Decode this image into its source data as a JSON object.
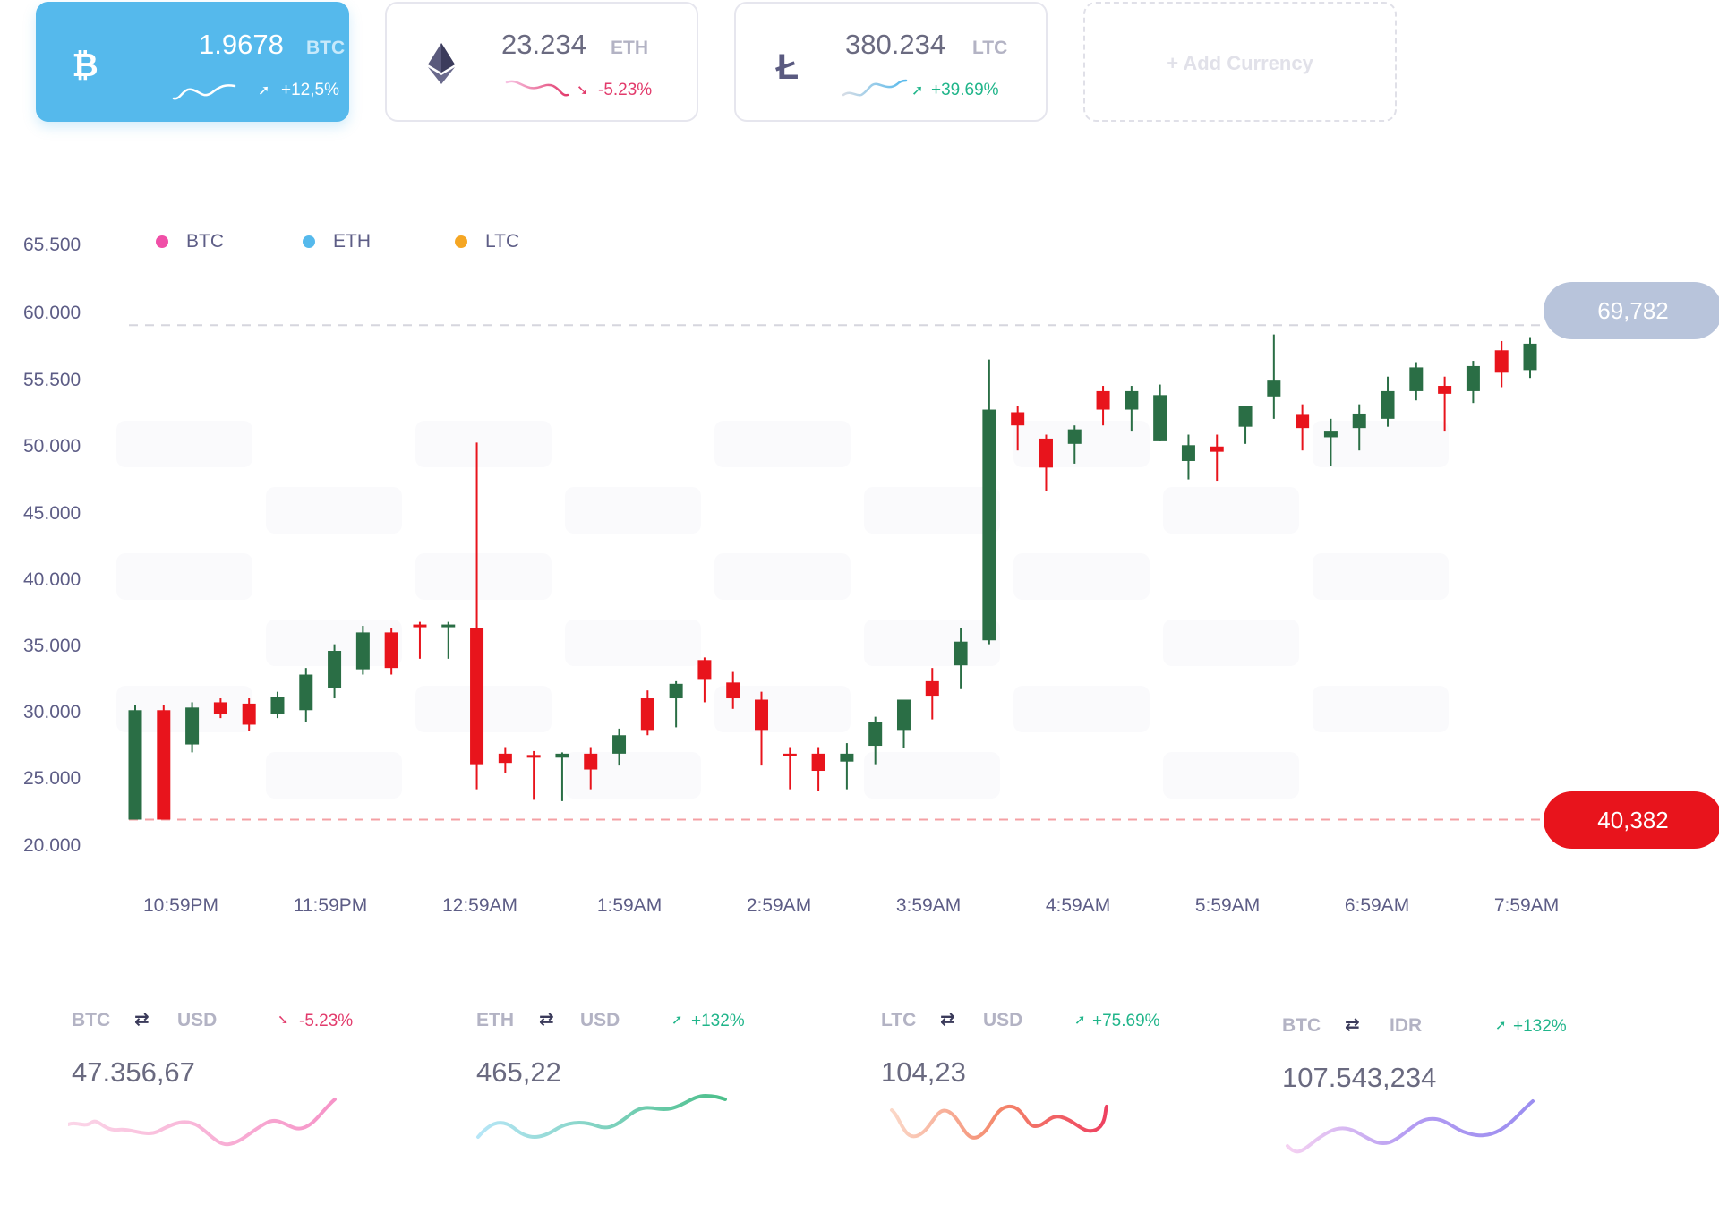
{
  "cards": [
    {
      "amount": "1.9678",
      "symbol": "BTC",
      "change": "+12,5%",
      "direction": "up",
      "coin_icon": "bitcoin-icon"
    },
    {
      "amount": "23.234",
      "symbol": "ETH",
      "change": "-5.23%",
      "direction": "down",
      "coin_icon": "ethereum-icon"
    },
    {
      "amount": "380.234",
      "symbol": "LTC",
      "change": "+39.69%",
      "direction": "up",
      "coin_icon": "litecoin-icon"
    }
  ],
  "add_currency_label": "+ Add Currency",
  "colors": {
    "active_card": "#55b9ec",
    "up": "#2a6e45",
    "down": "#e8141c",
    "pos_text": "#20b58a",
    "neg_text": "#e23a6b",
    "high_pill": "#b8c4db",
    "low_pill": "#e8141c"
  },
  "legend": [
    {
      "label": "BTC",
      "color": "#f04fa7"
    },
    {
      "label": "ETH",
      "color": "#55b9ec"
    },
    {
      "label": "LTC",
      "color": "#f5a623"
    }
  ],
  "high_label": "69,782",
  "low_label": "40,382",
  "chart_data": {
    "type": "candlestick",
    "y_ticks": [
      "65.500",
      "60.000",
      "55.500",
      "50.000",
      "45.000",
      "40.000",
      "35.000",
      "30.000",
      "25.000",
      "20.000"
    ],
    "ylim": [
      20000,
      65500
    ],
    "x_ticks": [
      "10:59PM",
      "11:59PM",
      "12:59AM",
      "1:59AM",
      "2:59AM",
      "3:59AM",
      "4:59AM",
      "5:59AM",
      "6:59AM",
      "7:59AM"
    ],
    "high_line": 59300,
    "low_line": 21800,
    "candles": [
      {
        "o": 21800,
        "h": 30500,
        "l": 21800,
        "c": 30100
      },
      {
        "o": 30100,
        "h": 30500,
        "l": 21800,
        "c": 21800
      },
      {
        "o": 27500,
        "h": 30700,
        "l": 26900,
        "c": 30300
      },
      {
        "o": 30700,
        "h": 31000,
        "l": 29500,
        "c": 29800
      },
      {
        "o": 30600,
        "h": 31000,
        "l": 28500,
        "c": 29000
      },
      {
        "o": 29800,
        "h": 31500,
        "l": 29500,
        "c": 31100
      },
      {
        "o": 30100,
        "h": 33300,
        "l": 29200,
        "c": 32800
      },
      {
        "o": 31800,
        "h": 35100,
        "l": 31000,
        "c": 34600
      },
      {
        "o": 33200,
        "h": 36500,
        "l": 32800,
        "c": 36000
      },
      {
        "o": 36000,
        "h": 36300,
        "l": 32800,
        "c": 33300
      },
      {
        "o": 36600,
        "h": 36800,
        "l": 34000,
        "c": 36400
      },
      {
        "o": 36400,
        "h": 36800,
        "l": 34000,
        "c": 36600
      },
      {
        "o": 36300,
        "h": 50400,
        "l": 24100,
        "c": 26000
      },
      {
        "o": 26800,
        "h": 27300,
        "l": 25300,
        "c": 26100
      },
      {
        "o": 26700,
        "h": 27000,
        "l": 23300,
        "c": 26500
      },
      {
        "o": 26500,
        "h": 26900,
        "l": 23200,
        "c": 26800
      },
      {
        "o": 26800,
        "h": 27300,
        "l": 24100,
        "c": 25600
      },
      {
        "o": 26800,
        "h": 28700,
        "l": 25900,
        "c": 28200
      },
      {
        "o": 31000,
        "h": 31600,
        "l": 28200,
        "c": 28600
      },
      {
        "o": 31000,
        "h": 32300,
        "l": 28800,
        "c": 32100
      },
      {
        "o": 33900,
        "h": 34100,
        "l": 30700,
        "c": 32400
      },
      {
        "o": 32200,
        "h": 33000,
        "l": 30200,
        "c": 31000
      },
      {
        "o": 30900,
        "h": 31500,
        "l": 25900,
        "c": 28600
      },
      {
        "o": 26800,
        "h": 27300,
        "l": 24100,
        "c": 26700
      },
      {
        "o": 26800,
        "h": 27300,
        "l": 24000,
        "c": 25500
      },
      {
        "o": 26200,
        "h": 27600,
        "l": 24100,
        "c": 26800
      },
      {
        "o": 27400,
        "h": 29600,
        "l": 26000,
        "c": 29200
      },
      {
        "o": 28600,
        "h": 30900,
        "l": 27200,
        "c": 30900
      },
      {
        "o": 32300,
        "h": 33300,
        "l": 29400,
        "c": 31200
      },
      {
        "o": 33500,
        "h": 36300,
        "l": 31700,
        "c": 35300
      },
      {
        "o": 35400,
        "h": 56700,
        "l": 35100,
        "c": 52900
      },
      {
        "o": 52700,
        "h": 53200,
        "l": 49800,
        "c": 51700
      },
      {
        "o": 50700,
        "h": 51000,
        "l": 46700,
        "c": 48500
      },
      {
        "o": 50300,
        "h": 51700,
        "l": 48800,
        "c": 51400
      },
      {
        "o": 54300,
        "h": 54700,
        "l": 51700,
        "c": 52900
      },
      {
        "o": 52900,
        "h": 54700,
        "l": 51300,
        "c": 54300
      },
      {
        "o": 50500,
        "h": 54800,
        "l": 50500,
        "c": 54000
      },
      {
        "o": 49000,
        "h": 51000,
        "l": 47600,
        "c": 50200
      },
      {
        "o": 50100,
        "h": 51000,
        "l": 47500,
        "c": 49700
      },
      {
        "o": 51600,
        "h": 53200,
        "l": 50300,
        "c": 53200
      },
      {
        "o": 53900,
        "h": 58600,
        "l": 52200,
        "c": 55100
      },
      {
        "o": 52500,
        "h": 53300,
        "l": 49800,
        "c": 51500
      },
      {
        "o": 50800,
        "h": 52200,
        "l": 48600,
        "c": 51300
      },
      {
        "o": 51500,
        "h": 53300,
        "l": 49800,
        "c": 52600
      },
      {
        "o": 52200,
        "h": 55400,
        "l": 51600,
        "c": 54300
      },
      {
        "o": 54300,
        "h": 56500,
        "l": 53600,
        "c": 56100
      },
      {
        "o": 54700,
        "h": 55400,
        "l": 51300,
        "c": 54100
      },
      {
        "o": 54300,
        "h": 56600,
        "l": 53400,
        "c": 56200
      },
      {
        "o": 57400,
        "h": 58100,
        "l": 54600,
        "c": 55700
      },
      {
        "o": 55900,
        "h": 58400,
        "l": 55300,
        "c": 57900
      }
    ]
  },
  "pairs": [
    {
      "from": "BTC",
      "to": "USD",
      "change": "-5.23%",
      "direction": "down",
      "value": "47.356,67"
    },
    {
      "from": "ETH",
      "to": "USD",
      "change": "+132%",
      "direction": "up",
      "value": "465,22"
    },
    {
      "from": "LTC",
      "to": "USD",
      "change": "+75.69%",
      "direction": "up",
      "value": "104,23"
    },
    {
      "from": "BTC",
      "to": "IDR",
      "change": "+132%",
      "direction": "up",
      "value": "107.543,234"
    }
  ],
  "icons": {
    "swap": "swap-arrows-icon",
    "up": "arrow-up-right-icon",
    "down": "arrow-down-right-icon"
  }
}
